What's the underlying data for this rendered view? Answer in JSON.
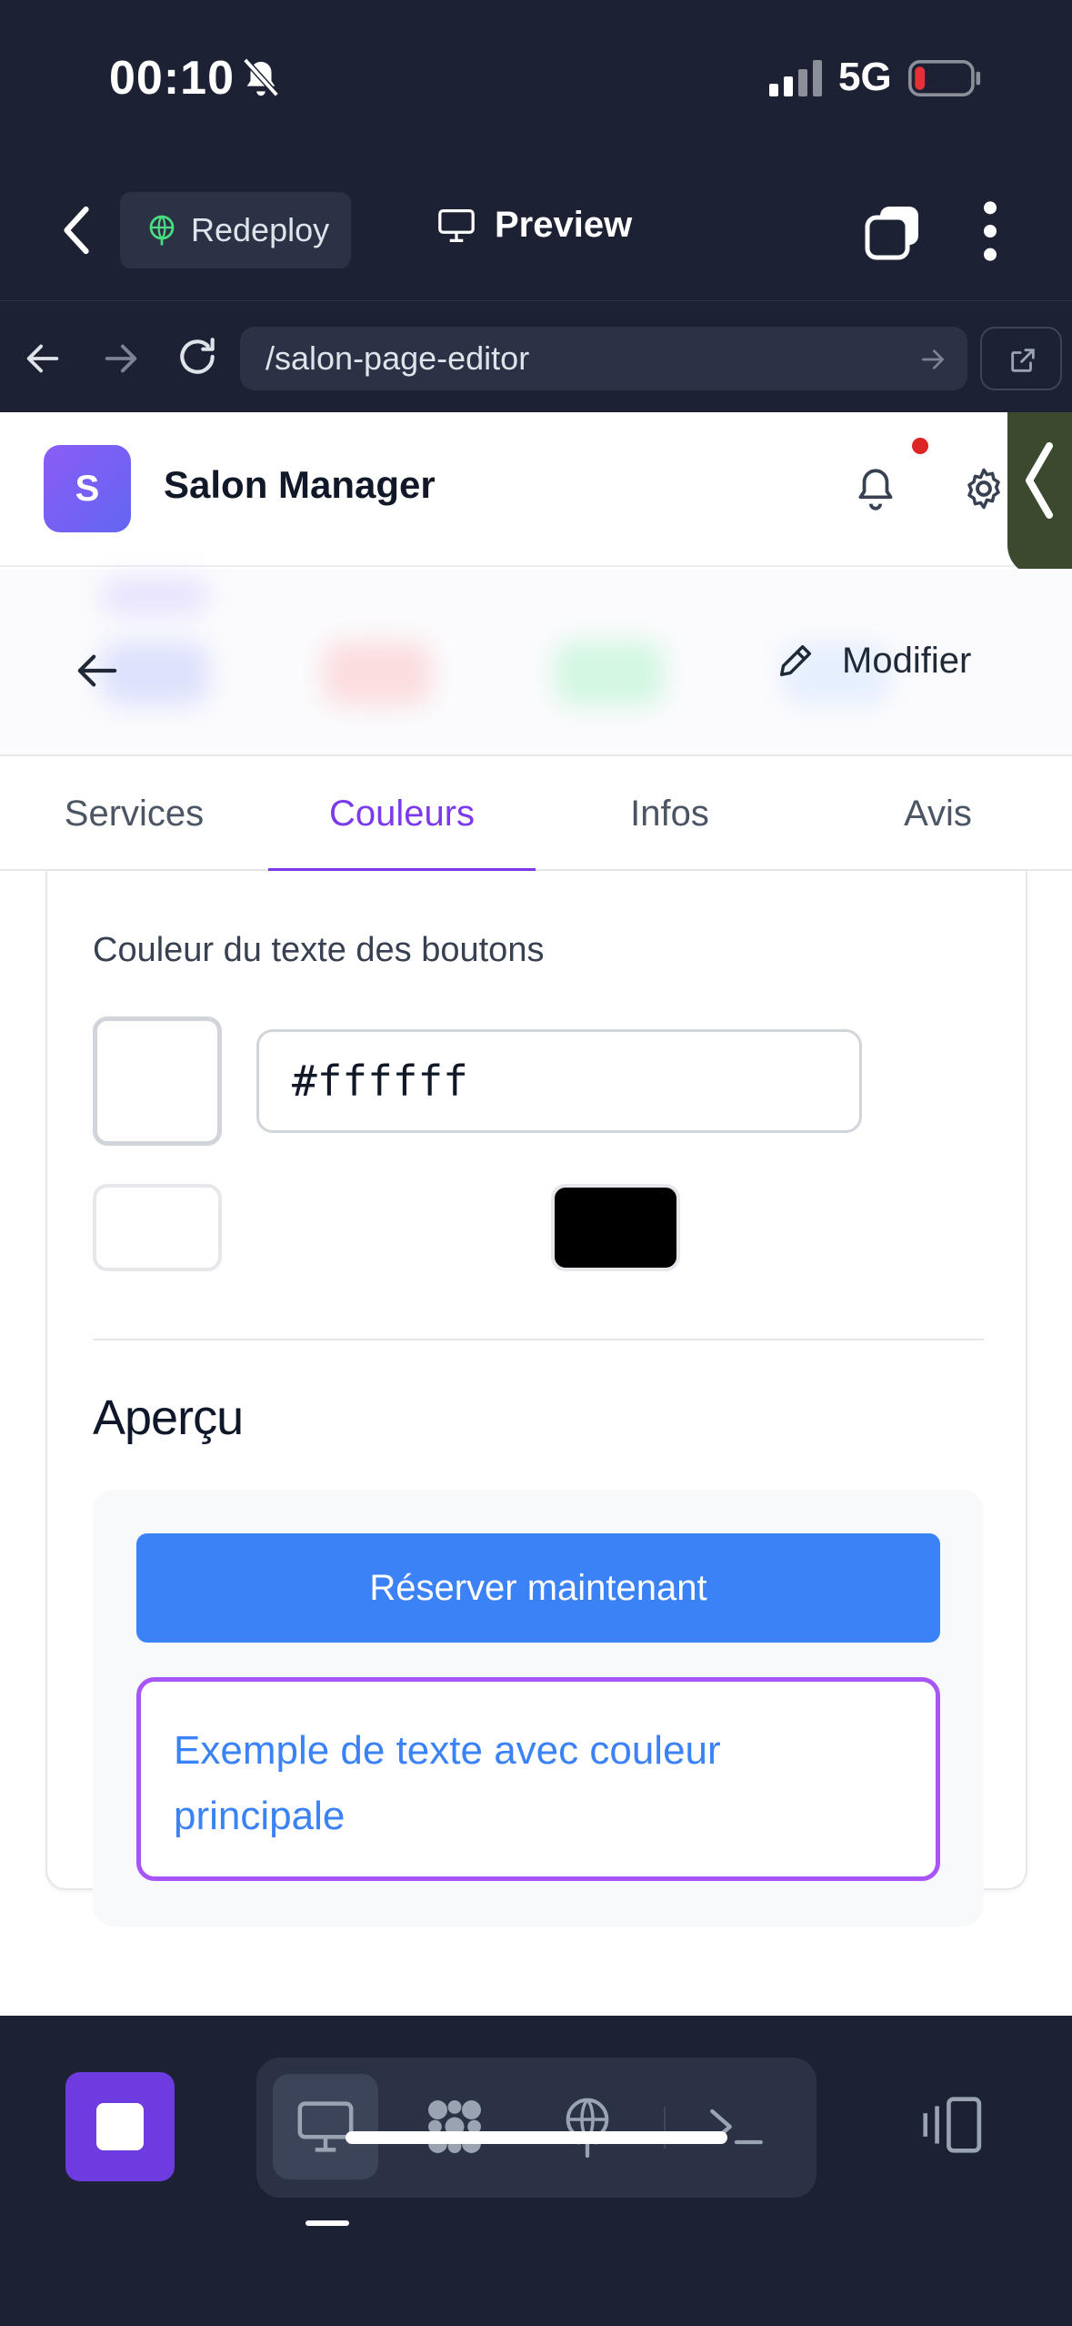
{
  "status_bar": {
    "time": "00:10",
    "network": "5G"
  },
  "topbar": {
    "redeploy_label": "Redeploy",
    "preview_label": "Preview"
  },
  "browser": {
    "url": "/salon-page-editor"
  },
  "app": {
    "logo_letter": "S",
    "title": "Salon Manager",
    "edit_label": "Modifier",
    "tabs": [
      {
        "label": "Services",
        "active": false
      },
      {
        "label": "Couleurs",
        "active": true
      },
      {
        "label": "Infos",
        "active": false
      },
      {
        "label": "Avis",
        "active": false
      }
    ],
    "color_section": {
      "label": "Couleur du texte des boutons",
      "value": "#ffffff",
      "swatches": [
        "#ffffff",
        "#000000"
      ]
    },
    "preview": {
      "title": "Aperçu",
      "button_label": "Réserver maintenant",
      "sample_text": "Exemple de texte avec couleur principale",
      "primary_color": "#3b82f6",
      "accent_border": "#a855f7"
    }
  },
  "colors": {
    "accent": "#7c3aed",
    "dock_bg": "#1c2233",
    "stop_button": "#6d3be0"
  }
}
